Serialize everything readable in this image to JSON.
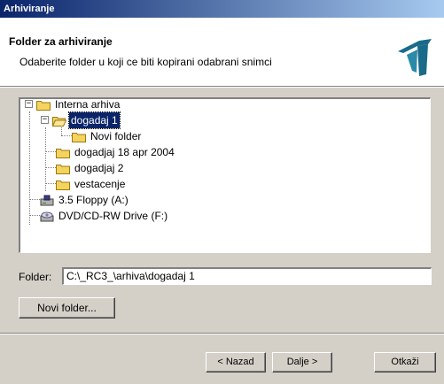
{
  "window": {
    "title": "Arhiviranje"
  },
  "header": {
    "title": "Folder za arhiviranje",
    "subtitle": "Odaberite folder u koji ce biti kopirani odabrani snimci"
  },
  "tree": {
    "items": [
      {
        "label": "Interna arhiva",
        "icon": "folder-icon",
        "expander": "−"
      },
      {
        "label": "dogadaj 1",
        "icon": "folder-open-icon",
        "expander": "−",
        "selected": true
      },
      {
        "label": "Novi folder",
        "icon": "folder-icon"
      },
      {
        "label": "dogadjaj 18 apr 2004",
        "icon": "folder-icon"
      },
      {
        "label": "dogadjaj 2",
        "icon": "folder-icon"
      },
      {
        "label": "vestacenje",
        "icon": "folder-icon"
      },
      {
        "label": "3.5 Floppy (A:)",
        "icon": "floppy-drive-icon"
      },
      {
        "label": "DVD/CD-RW Drive (F:)",
        "icon": "cd-drive-icon"
      }
    ]
  },
  "folder": {
    "label": "Folder:",
    "value": "C:\\_RC3_\\arhiva\\dogadaj 1"
  },
  "buttons": {
    "new_folder": "Novi folder...",
    "back": "< Nazad",
    "next": "Dalje >",
    "cancel": "Otkaži"
  },
  "colors": {
    "selection": "#0a246a",
    "folder": "#f4d35e",
    "face": "#d4d0c8"
  }
}
